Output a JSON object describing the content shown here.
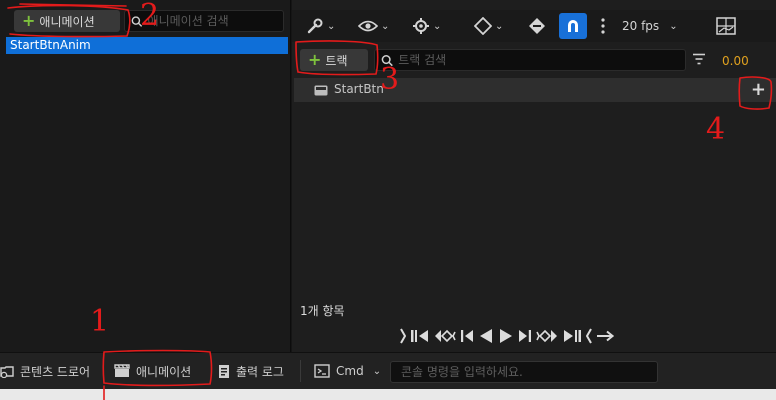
{
  "left": {
    "add_animation_label": "애니메이션",
    "search_placeholder": "애니메이션 검색",
    "animations": [
      "StartBtnAnim"
    ]
  },
  "toolbar": {
    "fps_label": "20 fps",
    "time_value": "0.00"
  },
  "tracks": {
    "add_track_label": "트랙",
    "search_placeholder": "트랙 검색",
    "items": [
      {
        "label": "StartBtn"
      }
    ],
    "add_button": "+",
    "count_label": "1개 항목"
  },
  "bottom": {
    "tabs": [
      {
        "label": "콘텐츠 드로어"
      },
      {
        "label": "애니메이션"
      },
      {
        "label": "출력 로그"
      }
    ],
    "cmd_label": "Cmd",
    "console_placeholder": "콘솔 명령을 입력하세요."
  },
  "annotations": [
    "1",
    "2",
    "3",
    "4"
  ],
  "colors": {
    "selection": "#0f6fd8",
    "accent_green": "#7ec23d",
    "time_orange": "#e0a11f",
    "annotation_red": "#e31b1b"
  }
}
